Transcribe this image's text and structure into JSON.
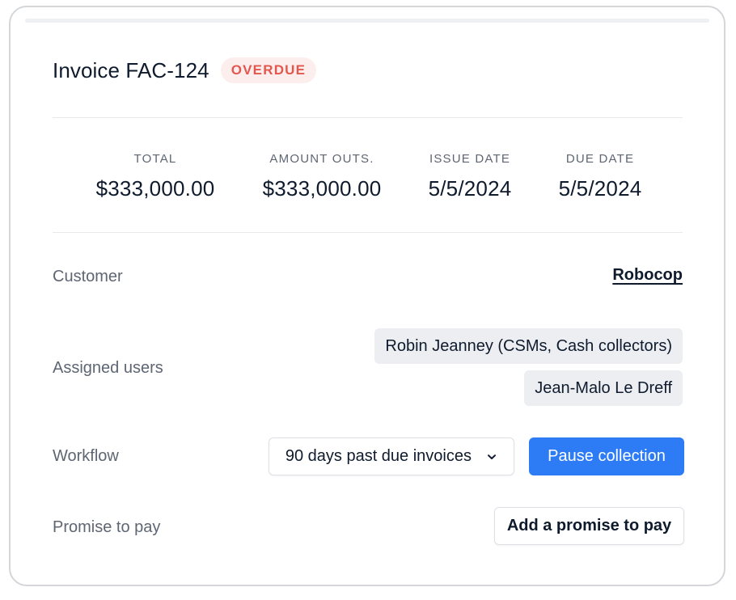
{
  "invoice": {
    "title": "Invoice FAC-124",
    "status_badge": "OVERDUE"
  },
  "stats": [
    {
      "label": "TOTAL",
      "value": "$333,000.00"
    },
    {
      "label": "AMOUNT OUTS.",
      "value": "$333,000.00"
    },
    {
      "label": "ISSUE DATE",
      "value": "5/5/2024"
    },
    {
      "label": "DUE DATE",
      "value": "5/5/2024"
    }
  ],
  "details": {
    "customer_label": "Customer",
    "customer_value": "Robocop",
    "assigned_users_label": "Assigned users",
    "assigned_users": [
      "Robin Jeanney (CSMs, Cash collectors)",
      "Jean-Malo Le Dreff"
    ],
    "workflow_label": "Workflow",
    "workflow_value": "90 days past due invoices",
    "pause_button_label": "Pause collection",
    "promise_label": "Promise to pay",
    "promise_button_label": "Add a promise to pay"
  },
  "icons": {
    "workflow_dropdown": "chevron-down-icon"
  },
  "colors": {
    "primary": "#2d7cf6",
    "overdue_text": "#e2584f",
    "overdue_background": "#fdeeee",
    "chip_background": "#eceef2",
    "text_primary": "#0f1b2d",
    "text_secondary": "#5e6673"
  }
}
